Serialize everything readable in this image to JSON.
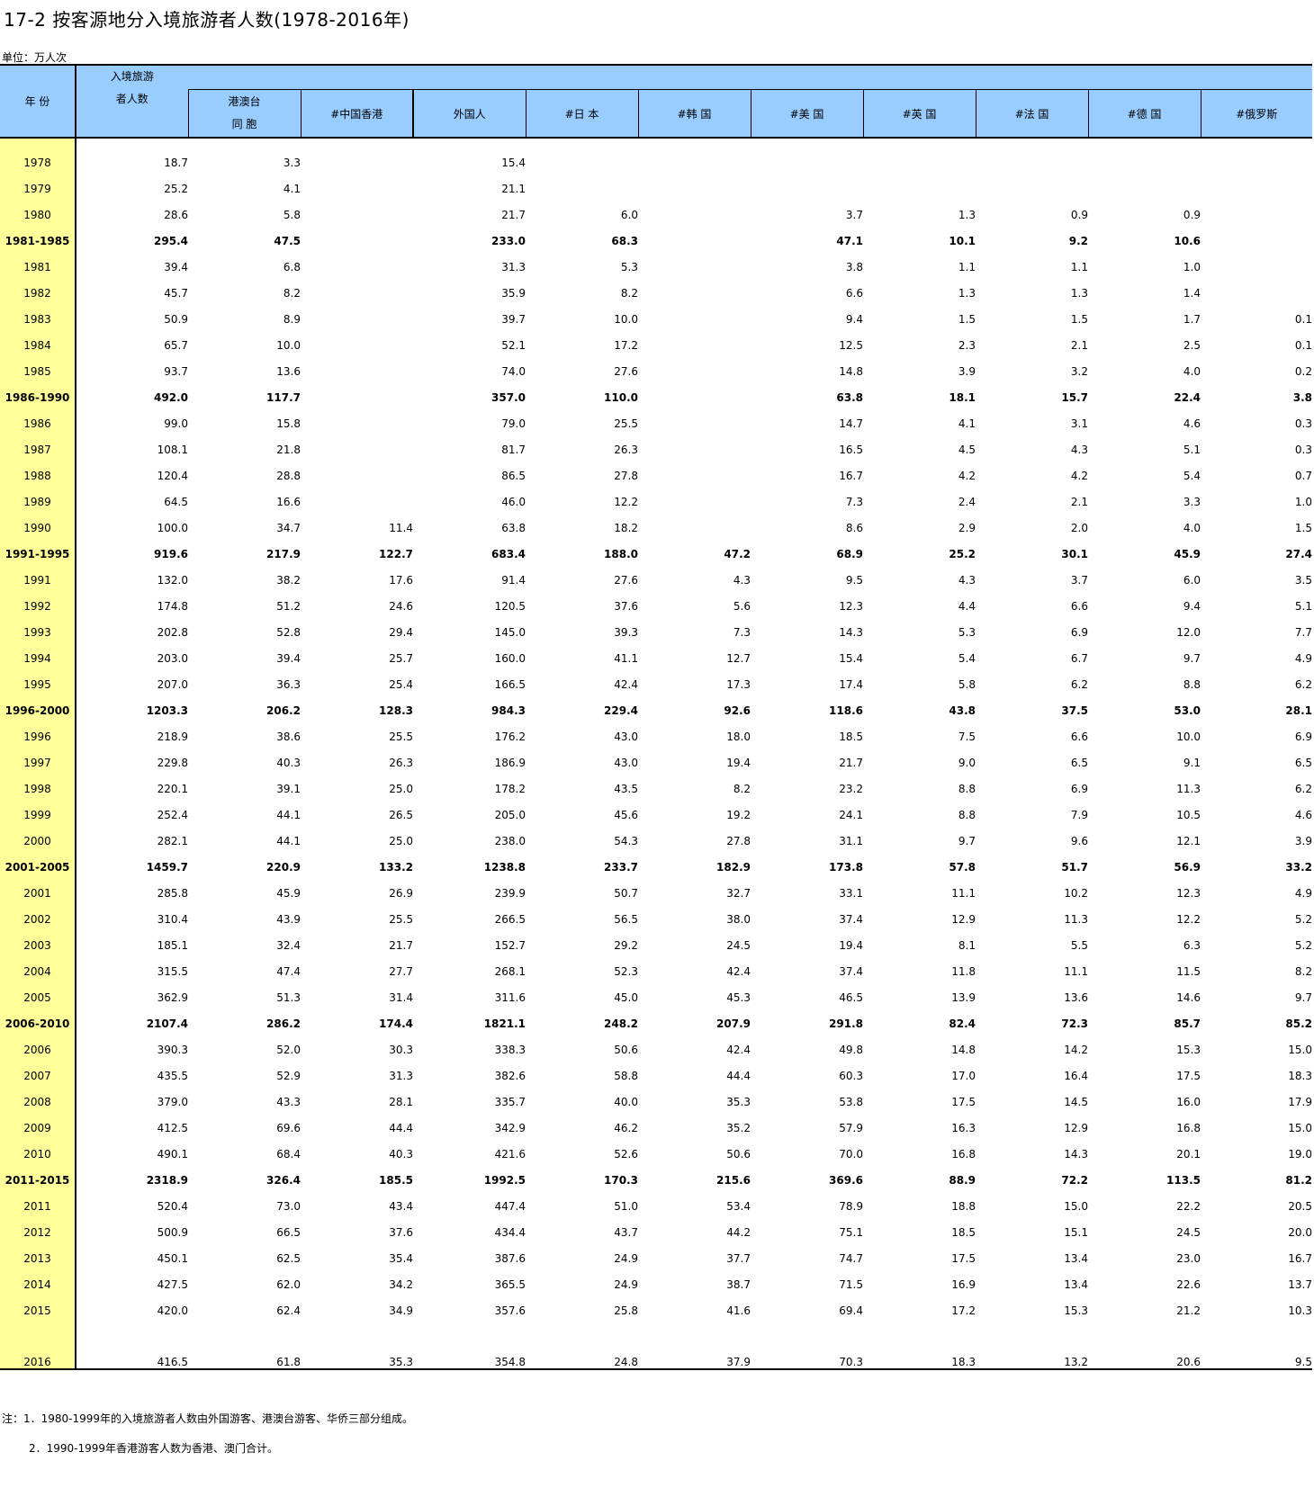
{
  "title": "17-2  按客源地分入境旅游者人数(1978-2016年)",
  "unit": "单位：万人次",
  "header": {
    "year": "年 份",
    "total_line1": "入境旅游",
    "total_line2": "者人数",
    "hkmt_line1": "港澳台",
    "hkmt_line2": "同 胞",
    "hk": "#中国香港",
    "foreign": "外国人",
    "japan": "#日 本",
    "korea": "#韩 国",
    "usa": "#美 国",
    "uk": "#英 国",
    "france": "#法 国",
    "germany": "#德 国",
    "russia": "#俄罗斯"
  },
  "rows": [
    {
      "year": "1978",
      "group": false,
      "v": [
        "18.7",
        "3.3",
        "",
        "15.4",
        "",
        "",
        "",
        "",
        "",
        "",
        ""
      ]
    },
    {
      "year": "1979",
      "group": false,
      "v": [
        "25.2",
        "4.1",
        "",
        "21.1",
        "",
        "",
        "",
        "",
        "",
        "",
        ""
      ]
    },
    {
      "year": "1980",
      "group": false,
      "v": [
        "28.6",
        "5.8",
        "",
        "21.7",
        "6.0",
        "",
        "3.7",
        "1.3",
        "0.9",
        "0.9",
        ""
      ]
    },
    {
      "year": "1981-1985",
      "group": true,
      "v": [
        "295.4",
        "47.5",
        "",
        "233.0",
        "68.3",
        "",
        "47.1",
        "10.1",
        "9.2",
        "10.6",
        ""
      ]
    },
    {
      "year": "1981",
      "group": false,
      "v": [
        "39.4",
        "6.8",
        "",
        "31.3",
        "5.3",
        "",
        "3.8",
        "1.1",
        "1.1",
        "1.0",
        ""
      ]
    },
    {
      "year": "1982",
      "group": false,
      "v": [
        "45.7",
        "8.2",
        "",
        "35.9",
        "8.2",
        "",
        "6.6",
        "1.3",
        "1.3",
        "1.4",
        ""
      ]
    },
    {
      "year": "1983",
      "group": false,
      "v": [
        "50.9",
        "8.9",
        "",
        "39.7",
        "10.0",
        "",
        "9.4",
        "1.5",
        "1.5",
        "1.7",
        "0.1"
      ]
    },
    {
      "year": "1984",
      "group": false,
      "v": [
        "65.7",
        "10.0",
        "",
        "52.1",
        "17.2",
        "",
        "12.5",
        "2.3",
        "2.1",
        "2.5",
        "0.1"
      ]
    },
    {
      "year": "1985",
      "group": false,
      "v": [
        "93.7",
        "13.6",
        "",
        "74.0",
        "27.6",
        "",
        "14.8",
        "3.9",
        "3.2",
        "4.0",
        "0.2"
      ]
    },
    {
      "year": "1986-1990",
      "group": true,
      "v": [
        "492.0",
        "117.7",
        "",
        "357.0",
        "110.0",
        "",
        "63.8",
        "18.1",
        "15.7",
        "22.4",
        "3.8"
      ]
    },
    {
      "year": "1986",
      "group": false,
      "v": [
        "99.0",
        "15.8",
        "",
        "79.0",
        "25.5",
        "",
        "14.7",
        "4.1",
        "3.1",
        "4.6",
        "0.3"
      ]
    },
    {
      "year": "1987",
      "group": false,
      "v": [
        "108.1",
        "21.8",
        "",
        "81.7",
        "26.3",
        "",
        "16.5",
        "4.5",
        "4.3",
        "5.1",
        "0.3"
      ]
    },
    {
      "year": "1988",
      "group": false,
      "v": [
        "120.4",
        "28.8",
        "",
        "86.5",
        "27.8",
        "",
        "16.7",
        "4.2",
        "4.2",
        "5.4",
        "0.7"
      ]
    },
    {
      "year": "1989",
      "group": false,
      "v": [
        "64.5",
        "16.6",
        "",
        "46.0",
        "12.2",
        "",
        "7.3",
        "2.4",
        "2.1",
        "3.3",
        "1.0"
      ]
    },
    {
      "year": "1990",
      "group": false,
      "v": [
        "100.0",
        "34.7",
        "11.4",
        "63.8",
        "18.2",
        "",
        "8.6",
        "2.9",
        "2.0",
        "4.0",
        "1.5"
      ]
    },
    {
      "year": "1991-1995",
      "group": true,
      "v": [
        "919.6",
        "217.9",
        "122.7",
        "683.4",
        "188.0",
        "47.2",
        "68.9",
        "25.2",
        "30.1",
        "45.9",
        "27.4"
      ]
    },
    {
      "year": "1991",
      "group": false,
      "v": [
        "132.0",
        "38.2",
        "17.6",
        "91.4",
        "27.6",
        "4.3",
        "9.5",
        "4.3",
        "3.7",
        "6.0",
        "3.5"
      ]
    },
    {
      "year": "1992",
      "group": false,
      "v": [
        "174.8",
        "51.2",
        "24.6",
        "120.5",
        "37.6",
        "5.6",
        "12.3",
        "4.4",
        "6.6",
        "9.4",
        "5.1"
      ]
    },
    {
      "year": "1993",
      "group": false,
      "v": [
        "202.8",
        "52.8",
        "29.4",
        "145.0",
        "39.3",
        "7.3",
        "14.3",
        "5.3",
        "6.9",
        "12.0",
        "7.7"
      ]
    },
    {
      "year": "1994",
      "group": false,
      "v": [
        "203.0",
        "39.4",
        "25.7",
        "160.0",
        "41.1",
        "12.7",
        "15.4",
        "5.4",
        "6.7",
        "9.7",
        "4.9"
      ]
    },
    {
      "year": "1995",
      "group": false,
      "v": [
        "207.0",
        "36.3",
        "25.4",
        "166.5",
        "42.4",
        "17.3",
        "17.4",
        "5.8",
        "6.2",
        "8.8",
        "6.2"
      ]
    },
    {
      "year": "1996-2000",
      "group": true,
      "v": [
        "1203.3",
        "206.2",
        "128.3",
        "984.3",
        "229.4",
        "92.6",
        "118.6",
        "43.8",
        "37.5",
        "53.0",
        "28.1"
      ]
    },
    {
      "year": "1996",
      "group": false,
      "v": [
        "218.9",
        "38.6",
        "25.5",
        "176.2",
        "43.0",
        "18.0",
        "18.5",
        "7.5",
        "6.6",
        "10.0",
        "6.9"
      ]
    },
    {
      "year": "1997",
      "group": false,
      "v": [
        "229.8",
        "40.3",
        "26.3",
        "186.9",
        "43.0",
        "19.4",
        "21.7",
        "9.0",
        "6.5",
        "9.1",
        "6.5"
      ]
    },
    {
      "year": "1998",
      "group": false,
      "v": [
        "220.1",
        "39.1",
        "25.0",
        "178.2",
        "43.5",
        "8.2",
        "23.2",
        "8.8",
        "6.9",
        "11.3",
        "6.2"
      ]
    },
    {
      "year": "1999",
      "group": false,
      "v": [
        "252.4",
        "44.1",
        "26.5",
        "205.0",
        "45.6",
        "19.2",
        "24.1",
        "8.8",
        "7.9",
        "10.5",
        "4.6"
      ]
    },
    {
      "year": "2000",
      "group": false,
      "v": [
        "282.1",
        "44.1",
        "25.0",
        "238.0",
        "54.3",
        "27.8",
        "31.1",
        "9.7",
        "9.6",
        "12.1",
        "3.9"
      ]
    },
    {
      "year": "2001-2005",
      "group": true,
      "v": [
        "1459.7",
        "220.9",
        "133.2",
        "1238.8",
        "233.7",
        "182.9",
        "173.8",
        "57.8",
        "51.7",
        "56.9",
        "33.2"
      ]
    },
    {
      "year": "2001",
      "group": false,
      "v": [
        "285.8",
        "45.9",
        "26.9",
        "239.9",
        "50.7",
        "32.7",
        "33.1",
        "11.1",
        "10.2",
        "12.3",
        "4.9"
      ]
    },
    {
      "year": "2002",
      "group": false,
      "v": [
        "310.4",
        "43.9",
        "25.5",
        "266.5",
        "56.5",
        "38.0",
        "37.4",
        "12.9",
        "11.3",
        "12.2",
        "5.2"
      ]
    },
    {
      "year": "2003",
      "group": false,
      "v": [
        "185.1",
        "32.4",
        "21.7",
        "152.7",
        "29.2",
        "24.5",
        "19.4",
        "8.1",
        "5.5",
        "6.3",
        "5.2"
      ]
    },
    {
      "year": "2004",
      "group": false,
      "v": [
        "315.5",
        "47.4",
        "27.7",
        "268.1",
        "52.3",
        "42.4",
        "37.4",
        "11.8",
        "11.1",
        "11.5",
        "8.2"
      ]
    },
    {
      "year": "2005",
      "group": false,
      "v": [
        "362.9",
        "51.3",
        "31.4",
        "311.6",
        "45.0",
        "45.3",
        "46.5",
        "13.9",
        "13.6",
        "14.6",
        "9.7"
      ]
    },
    {
      "year": "2006-2010",
      "group": true,
      "v": [
        "2107.4",
        "286.2",
        "174.4",
        "1821.1",
        "248.2",
        "207.9",
        "291.8",
        "82.4",
        "72.3",
        "85.7",
        "85.2"
      ]
    },
    {
      "year": "2006",
      "group": false,
      "v": [
        "390.3",
        "52.0",
        "30.3",
        "338.3",
        "50.6",
        "42.4",
        "49.8",
        "14.8",
        "14.2",
        "15.3",
        "15.0"
      ]
    },
    {
      "year": "2007",
      "group": false,
      "v": [
        "435.5",
        "52.9",
        "31.3",
        "382.6",
        "58.8",
        "44.4",
        "60.3",
        "17.0",
        "16.4",
        "17.5",
        "18.3"
      ]
    },
    {
      "year": "2008",
      "group": false,
      "v": [
        "379.0",
        "43.3",
        "28.1",
        "335.7",
        "40.0",
        "35.3",
        "53.8",
        "17.5",
        "14.5",
        "16.0",
        "17.9"
      ]
    },
    {
      "year": "2009",
      "group": false,
      "v": [
        "412.5",
        "69.6",
        "44.4",
        "342.9",
        "46.2",
        "35.2",
        "57.9",
        "16.3",
        "12.9",
        "16.8",
        "15.0"
      ]
    },
    {
      "year": "2010",
      "group": false,
      "v": [
        "490.1",
        "68.4",
        "40.3",
        "421.6",
        "52.6",
        "50.6",
        "70.0",
        "16.8",
        "14.3",
        "20.1",
        "19.0"
      ]
    },
    {
      "year": "2011-2015",
      "group": true,
      "v": [
        "2318.9",
        "326.4",
        "185.5",
        "1992.5",
        "170.3",
        "215.6",
        "369.6",
        "88.9",
        "72.2",
        "113.5",
        "81.2"
      ]
    },
    {
      "year": "2011",
      "group": false,
      "v": [
        "520.4",
        "73.0",
        "43.4",
        "447.4",
        "51.0",
        "53.4",
        "78.9",
        "18.8",
        "15.0",
        "22.2",
        "20.5"
      ]
    },
    {
      "year": "2012",
      "group": false,
      "v": [
        "500.9",
        "66.5",
        "37.6",
        "434.4",
        "43.7",
        "44.2",
        "75.1",
        "18.5",
        "15.1",
        "24.5",
        "20.0"
      ]
    },
    {
      "year": "2013",
      "group": false,
      "v": [
        "450.1",
        "62.5",
        "35.4",
        "387.6",
        "24.9",
        "37.7",
        "74.7",
        "17.5",
        "13.4",
        "23.0",
        "16.7"
      ]
    },
    {
      "year": "2014",
      "group": false,
      "v": [
        "427.5",
        "62.0",
        "34.2",
        "365.5",
        "24.9",
        "38.7",
        "71.5",
        "16.9",
        "13.4",
        "22.6",
        "13.7"
      ]
    },
    {
      "year": "2015",
      "group": false,
      "v": [
        "420.0",
        "62.4",
        "34.9",
        "357.6",
        "25.8",
        "41.6",
        "69.4",
        "17.2",
        "15.3",
        "21.2",
        "10.3"
      ]
    },
    {
      "year": "",
      "group": false,
      "gap": true,
      "v": [
        "",
        "",
        "",
        "",
        "",
        "",
        "",
        "",
        "",
        "",
        ""
      ]
    },
    {
      "year": "2016",
      "group": false,
      "v": [
        "416.5",
        "61.8",
        "35.3",
        "354.8",
        "24.8",
        "37.9",
        "70.3",
        "18.3",
        "13.2",
        "20.6",
        "9.5"
      ]
    }
  ],
  "notes": {
    "note1": "注：1．1980-1999年的入境旅游者人数由外国游客、港澳台游客、华侨三部分组成。",
    "note2": "2．1990-1999年香港游客人数为香港、澳门合计。"
  }
}
